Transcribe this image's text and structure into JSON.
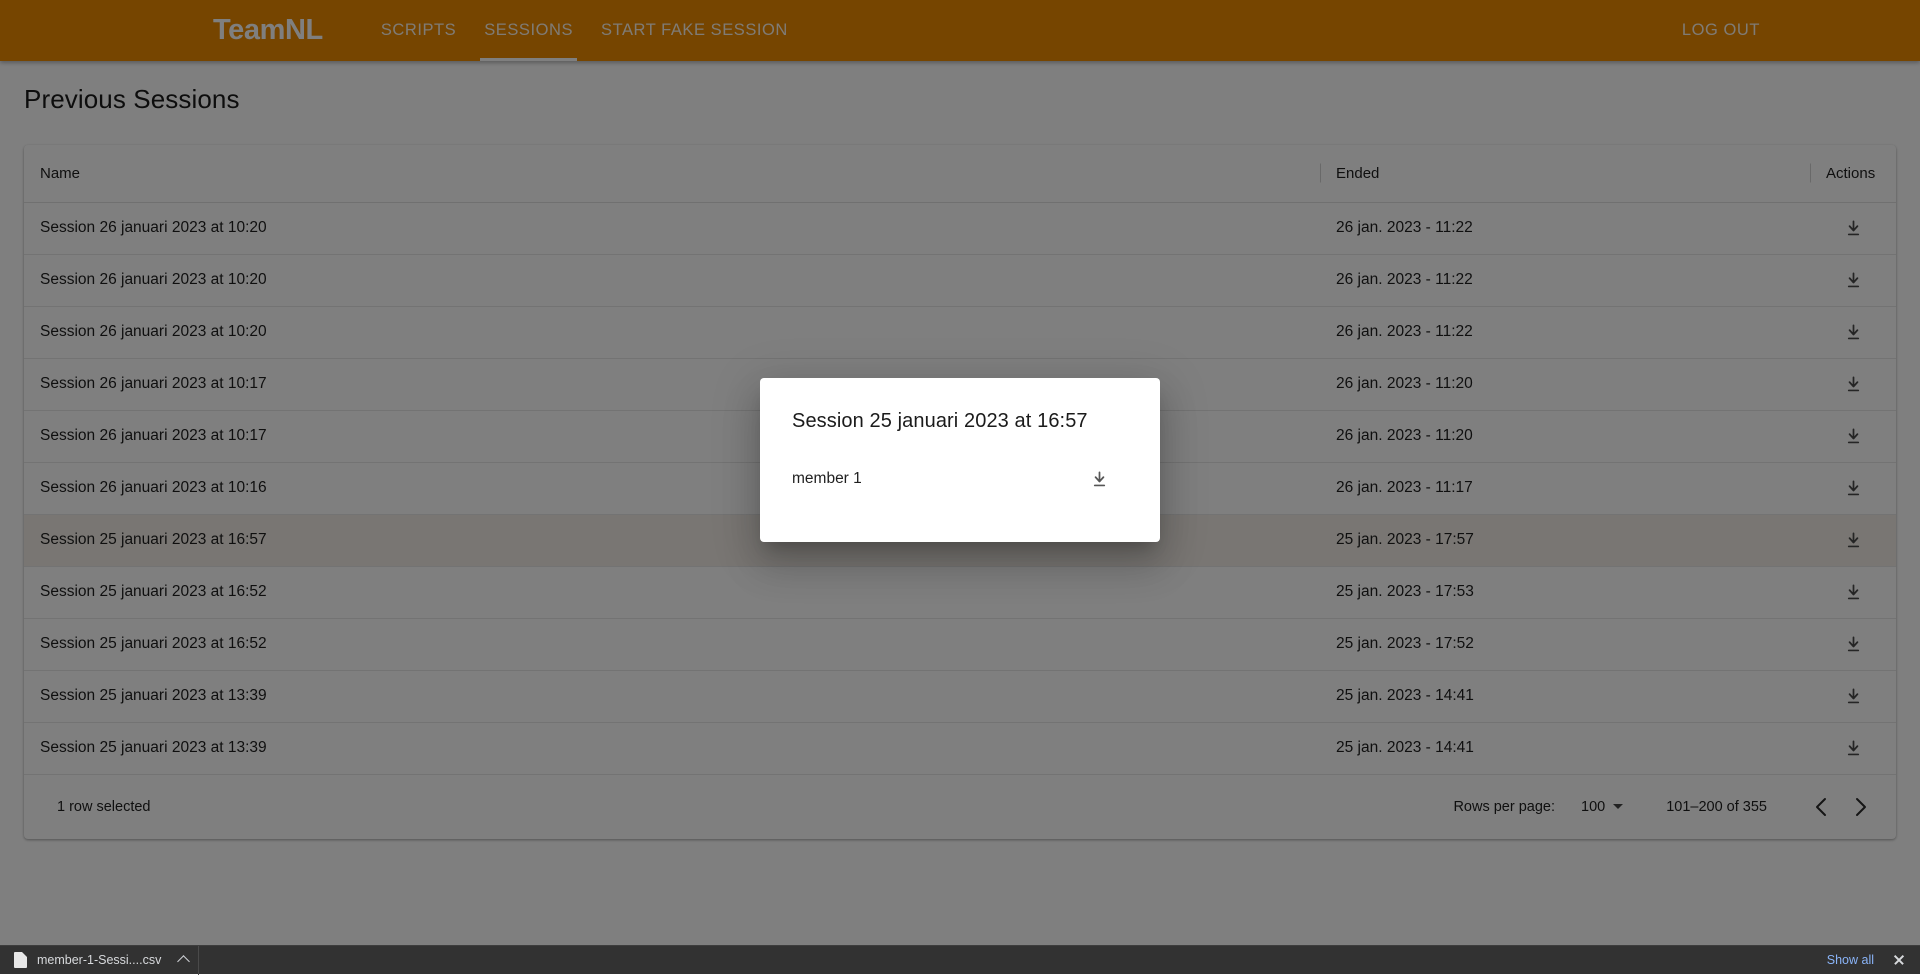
{
  "header": {
    "brand": "TeamNL",
    "nav": [
      {
        "label": "SCRIPTS",
        "active": false
      },
      {
        "label": "SESSIONS",
        "active": true
      },
      {
        "label": "START FAKE SESSION",
        "active": false
      }
    ],
    "logout_label": "LOG OUT",
    "brand_color": "#ED8B00"
  },
  "main": {
    "page_title": "Previous Sessions",
    "table": {
      "columns": [
        "Name",
        "Ended",
        "Actions"
      ],
      "rows": [
        {
          "name": "Session 26 januari 2023 at 10:20",
          "ended": "26 jan. 2023 - 11:22",
          "action_icon": "download-icon",
          "selected": false
        },
        {
          "name": "Session 26 januari 2023 at 10:20",
          "ended": "26 jan. 2023 - 11:22",
          "action_icon": "download-icon",
          "selected": false
        },
        {
          "name": "Session 26 januari 2023 at 10:20",
          "ended": "26 jan. 2023 - 11:22",
          "action_icon": "download-icon",
          "selected": false
        },
        {
          "name": "Session 26 januari 2023 at 10:17",
          "ended": "26 jan. 2023 - 11:20",
          "action_icon": "download-icon",
          "selected": false
        },
        {
          "name": "Session 26 januari 2023 at 10:17",
          "ended": "26 jan. 2023 - 11:20",
          "action_icon": "download-icon",
          "selected": false
        },
        {
          "name": "Session 26 januari 2023 at 10:16",
          "ended": "26 jan. 2023 - 11:17",
          "action_icon": "download-icon",
          "selected": false
        },
        {
          "name": "Session 25 januari 2023 at 16:57",
          "ended": "25 jan. 2023 - 17:57",
          "action_icon": "download-icon",
          "selected": true
        },
        {
          "name": "Session 25 januari 2023 at 16:52",
          "ended": "25 jan. 2023 - 17:53",
          "action_icon": "download-icon",
          "selected": false
        },
        {
          "name": "Session 25 januari 2023 at 16:52",
          "ended": "25 jan. 2023 - 17:52",
          "action_icon": "download-icon",
          "selected": false
        },
        {
          "name": "Session 25 januari 2023 at 13:39",
          "ended": "25 jan. 2023 - 14:41",
          "action_icon": "download-icon",
          "selected": false
        },
        {
          "name": "Session 25 januari 2023 at 13:39",
          "ended": "25 jan. 2023 - 14:41",
          "action_icon": "download-icon",
          "selected": false
        }
      ]
    },
    "footer": {
      "selection_text": "1 row selected",
      "rows_per_page_label": "Rows per page:",
      "rows_per_page_value": "100",
      "range_text": "101–200 of 355",
      "prev_icon": "chevron-left-icon",
      "next_icon": "chevron-right-icon"
    }
  },
  "dialog": {
    "title": "Session 25 januari 2023 at 16:57",
    "member_label": "member 1",
    "download_icon": "download-icon"
  },
  "download_shelf": {
    "file_icon": "file-icon",
    "file_name": "member-1-Sessi....csv",
    "expand_icon": "chevron-up-icon",
    "show_all_label": "Show all",
    "show_all_color": "#8ab4f8",
    "close_icon": "close-icon"
  }
}
